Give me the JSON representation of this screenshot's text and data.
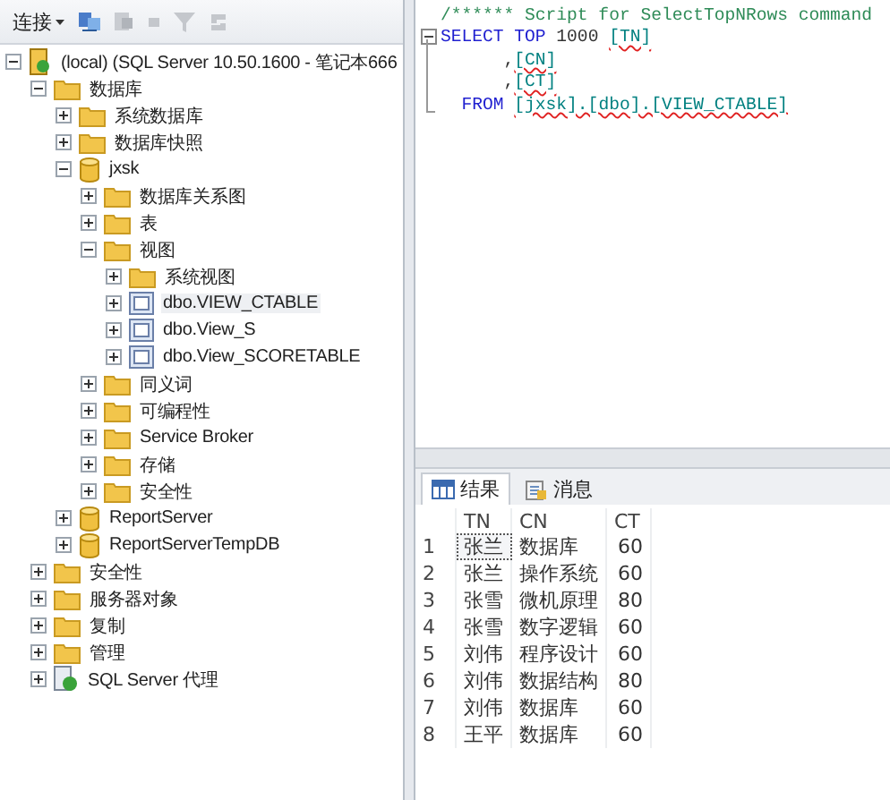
{
  "explorer": {
    "toolbar": {
      "connect_label": "连接"
    },
    "tree": [
      {
        "label": "(local) (SQL Server 10.50.1600 - 笔记本666",
        "kind": "server",
        "expanded": true,
        "children": [
          {
            "label": "数据库",
            "kind": "folder",
            "expanded": true,
            "children": [
              {
                "label": "系统数据库",
                "kind": "folder",
                "expanded": false
              },
              {
                "label": "数据库快照",
                "kind": "folder",
                "expanded": false
              },
              {
                "label": "jxsk",
                "kind": "database",
                "expanded": true,
                "children": [
                  {
                    "label": "数据库关系图",
                    "kind": "folder",
                    "expanded": false
                  },
                  {
                    "label": "表",
                    "kind": "folder",
                    "expanded": false
                  },
                  {
                    "label": "视图",
                    "kind": "folder",
                    "expanded": true,
                    "children": [
                      {
                        "label": "系统视图",
                        "kind": "folder",
                        "expanded": false
                      },
                      {
                        "label": "dbo.VIEW_CTABLE",
                        "kind": "view",
                        "expanded": false,
                        "selected": true
                      },
                      {
                        "label": "dbo.View_S",
                        "kind": "view",
                        "expanded": false,
                        "selected": false
                      },
                      {
                        "label": "dbo.View_SCORETABLE",
                        "kind": "view",
                        "expanded": false,
                        "selected": false
                      }
                    ]
                  },
                  {
                    "label": "同义词",
                    "kind": "folder",
                    "expanded": false
                  },
                  {
                    "label": "可编程性",
                    "kind": "folder",
                    "expanded": false
                  },
                  {
                    "label": "Service Broker",
                    "kind": "folder",
                    "expanded": false
                  },
                  {
                    "label": "存储",
                    "kind": "folder",
                    "expanded": false
                  },
                  {
                    "label": "安全性",
                    "kind": "folder",
                    "expanded": false
                  }
                ]
              },
              {
                "label": "ReportServer",
                "kind": "database",
                "expanded": false
              },
              {
                "label": "ReportServerTempDB",
                "kind": "database",
                "expanded": false
              }
            ]
          },
          {
            "label": "安全性",
            "kind": "folder",
            "expanded": false
          },
          {
            "label": "服务器对象",
            "kind": "folder",
            "expanded": false
          },
          {
            "label": "复制",
            "kind": "folder",
            "expanded": false
          },
          {
            "label": "管理",
            "kind": "folder",
            "expanded": false
          },
          {
            "label": "SQL Server 代理",
            "kind": "agent",
            "expanded": false
          }
        ]
      }
    ]
  },
  "editor": {
    "lines": [
      {
        "collapsible": false,
        "segments": [
          {
            "kind": "comment",
            "text": "/****** Script for SelectTopNRows command"
          }
        ]
      },
      {
        "collapsible": true,
        "segments": [
          {
            "kind": "keyword",
            "text": "SELECT TOP"
          },
          {
            "kind": "plain",
            "text": " 1000 "
          },
          {
            "kind": "ident",
            "text": "[TN]"
          }
        ]
      },
      {
        "collapsible": false,
        "segments": [
          {
            "kind": "plain",
            "text": "      ,"
          },
          {
            "kind": "ident",
            "text": "[CN]"
          }
        ]
      },
      {
        "collapsible": false,
        "segments": [
          {
            "kind": "plain",
            "text": "      ,"
          },
          {
            "kind": "ident",
            "text": "[CT]"
          }
        ]
      },
      {
        "collapsible": false,
        "segments": [
          {
            "kind": "keyword",
            "text": "  FROM "
          },
          {
            "kind": "ident",
            "text": "[jxsk].[dbo].[VIEW_CTABLE]"
          }
        ]
      }
    ]
  },
  "results": {
    "tabs": [
      {
        "label": "结果",
        "kind": "grid",
        "selected": true
      },
      {
        "label": "消息",
        "kind": "messages",
        "selected": false
      }
    ],
    "columns": [
      "TN",
      "CN",
      "CT"
    ],
    "rows": [
      {
        "number": "1",
        "cells": [
          "张兰",
          "数据库",
          "60"
        ],
        "selected": true
      },
      {
        "number": "2",
        "cells": [
          "张兰",
          "操作系统",
          "60"
        ],
        "selected": false
      },
      {
        "number": "3",
        "cells": [
          "张雪",
          "微机原理",
          "80"
        ],
        "selected": false
      },
      {
        "number": "4",
        "cells": [
          "张雪",
          "数字逻辑",
          "60"
        ],
        "selected": false
      },
      {
        "number": "5",
        "cells": [
          "刘伟",
          "程序设计",
          "60"
        ],
        "selected": false
      },
      {
        "number": "6",
        "cells": [
          "刘伟",
          "数据结构",
          "80"
        ],
        "selected": false
      },
      {
        "number": "7",
        "cells": [
          "刘伟",
          "数据库",
          "60"
        ],
        "selected": false
      },
      {
        "number": "8",
        "cells": [
          "王平",
          "数据库",
          "60"
        ],
        "selected": false
      }
    ]
  }
}
